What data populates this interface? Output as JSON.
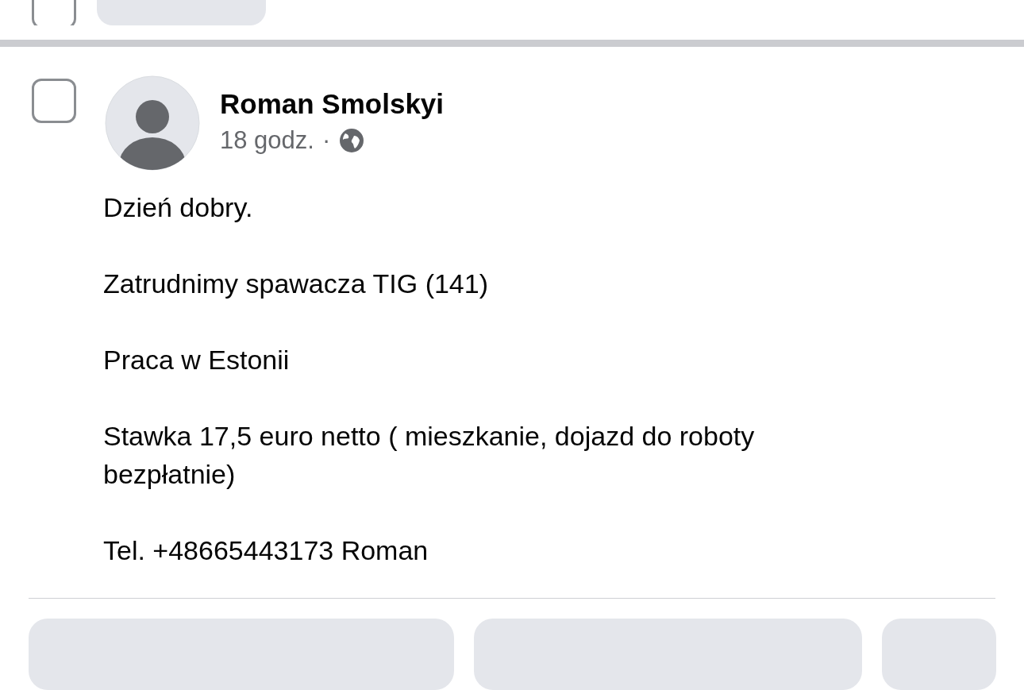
{
  "top_bar": {
    "checkbox": {
      "checked": false
    }
  },
  "post": {
    "checkbox": {
      "checked": false
    },
    "author": "Roman Smolskyi",
    "time": "18 godz.",
    "separator": "·",
    "paragraphs": [
      "Dzień dobry.",
      "Zatrudnimy spawacza TIG (141)",
      "Praca w Estonii",
      "Stawka 17,5 euro netto ( mieszkanie, dojazd do roboty bezpłatnie)",
      "Tel. +48665443173 Roman"
    ]
  }
}
